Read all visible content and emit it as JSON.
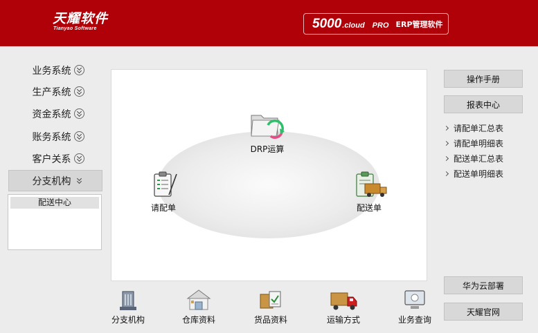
{
  "header": {
    "logo_cn": "天耀软件",
    "logo_en": "Tianyao Software",
    "product_number": "5000",
    "product_cloud": ".cloud",
    "product_pro": "PRO",
    "product_name": "ERP管理软件"
  },
  "nav": {
    "items": [
      {
        "label": "业务系统"
      },
      {
        "label": "生产系统"
      },
      {
        "label": "资金系统"
      },
      {
        "label": "账务系统"
      },
      {
        "label": "客户关系"
      },
      {
        "label": "分支机构"
      }
    ],
    "active_index": 5,
    "sub_items": [
      {
        "label": "配送中心"
      }
    ]
  },
  "canvas": {
    "nodes": [
      {
        "label": "DRP运算",
        "icon": "drp-folder-icon"
      },
      {
        "label": "请配单",
        "icon": "clipboard-icon"
      },
      {
        "label": "配送单",
        "icon": "delivery-truck-icon"
      }
    ]
  },
  "bottom": {
    "items": [
      {
        "label": "分支机构",
        "icon": "building-icon"
      },
      {
        "label": "仓库资料",
        "icon": "warehouse-icon"
      },
      {
        "label": "货品资料",
        "icon": "goods-box-icon"
      },
      {
        "label": "运输方式",
        "icon": "truck-icon"
      },
      {
        "label": "业务查询",
        "icon": "monitor-icon"
      }
    ]
  },
  "right": {
    "manual_button": "操作手册",
    "report_button": "报表中心",
    "report_links": [
      {
        "label": "请配单汇总表"
      },
      {
        "label": "请配单明细表"
      },
      {
        "label": "配送单汇总表"
      },
      {
        "label": "配送单明细表"
      }
    ],
    "huawei_button": "华为云部署",
    "official_button": "天耀官网"
  },
  "colors": {
    "header_bg": "#b00008",
    "page_bg": "#ececec"
  }
}
